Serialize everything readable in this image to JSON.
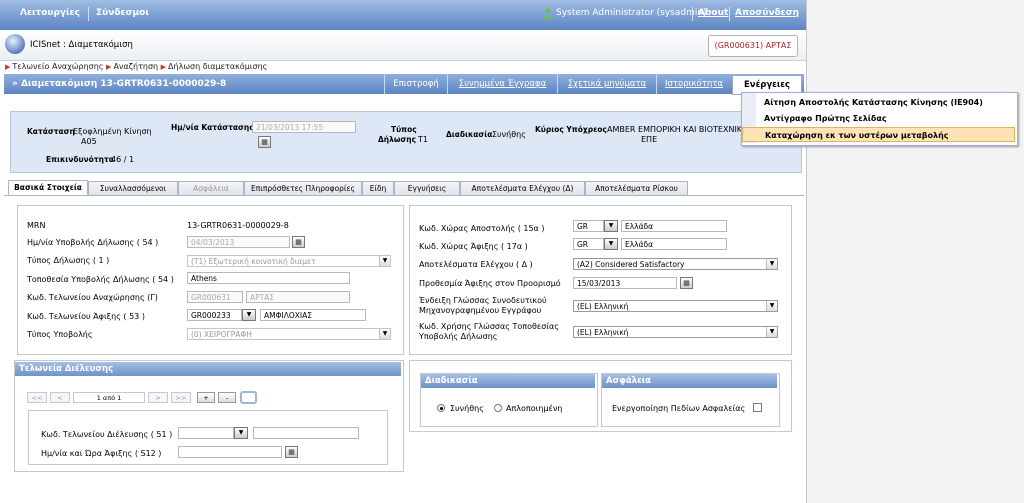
{
  "topbar": {
    "menu_functions": "Λειτουργίες",
    "menu_links": "Σύνδεσμοι",
    "user": "System Administrator (sysadmin)",
    "about": "About",
    "logout": "Αποσύνδεση"
  },
  "header": {
    "app_title": "ICISnet : Διαμετακόμιση",
    "context_office": "(GR000631) ΑΡΤΑΣ"
  },
  "breadcrumb": [
    "Τελωνείο Αναχώρησης",
    "Αναζήτηση",
    "Δήλωση διαμετακόμισης"
  ],
  "titlebar": {
    "title": "» Διαμετακόμιση 13-GRTR0631-0000029-8",
    "btn_back": "Επιστροφή",
    "btn_attachments": "Συνημμένα Έγγραφα",
    "btn_messages": "Σχετικά μηνύματα",
    "btn_history": "Ιστορικότητα",
    "btn_actions": "Ενέργειες"
  },
  "actions_menu": [
    "Αίτηση Αποστολής Κατάστασης Κίνησης (IE904)",
    "Αντίγραφο Πρώτης Σελίδας",
    "Καταχώρηση εκ των υστέρων μεταβολής"
  ],
  "status": {
    "state_label": "Κατάσταση",
    "state_value_1": "Εξοφλημένη Κίνηση",
    "state_value_2": "A05",
    "date_label": "Ημ/νία Κατάστασης",
    "date_value": "21/03/2013 17:55",
    "type_label_1": "Τύπος",
    "type_label_2": "Δήλωσης",
    "type_value": "T1",
    "procedure_label": "Διαδικασία",
    "procedure_value": "Συνήθης",
    "principal_label": "Κύριος Υπόχρεος",
    "principal_value_1": "AMBER ΕΜΠΟΡΙΚΗ ΚΑΙ ΒΙΟΤΕΧΝΙΚΗ",
    "principal_value_2": "ΕΠΕ",
    "risk_label": "Επικινδυνότητα",
    "risk_value": "46 / 1"
  },
  "tabs": [
    "Βασικά Στοιχεία",
    "Συναλλασσόμενοι",
    "Ασφάλεια",
    "Επιπρόσθετες Πληροφορίες",
    "Είδη",
    "Εγγυήσεις",
    "Αποτελέσματα Ελέγχου (Δ)",
    "Αποτελέσματα Ρίσκου"
  ],
  "left_form": {
    "mrn_label": "MRN",
    "mrn_value": "13-GRTR0631-0000029-8",
    "submit_date_label": "Ημ/νία Υποβολής Δήλωσης ( 54 )",
    "submit_date_value": "04/03/2013",
    "decl_type_label": "Τύπος Δήλωσης ( 1 )",
    "decl_type_value": "(T1) Εξωτερική κοινοτική διαμετ",
    "place_label": "Τοποθεσία Υποβολής Δήλωσης ( 54 )",
    "place_value": "Athens",
    "dep_office_label": "Κωδ. Τελωνείου Αναχώρησης (Γ)",
    "dep_office_code": "GR000631",
    "dep_office_name": "ΑΡΤΑΣ",
    "dest_office_label": "Κωδ. Τελωνείου Άφιξης ( 53 )",
    "dest_office_code": "GR000233",
    "dest_office_name": "ΑΜΦΙΛΟΧΙΑΣ",
    "submission_type_label": "Τύπος Υποβολής",
    "submission_type_value": "(0) ΧΕΙΡΟΓΡΑΦΗ"
  },
  "right_form": {
    "dispatch_country_label": "Κωδ. Χώρας Αποστολής ( 15α )",
    "dispatch_country_code": "GR",
    "dispatch_country_name": "Ελλάδα",
    "dest_country_label": "Κωδ. Χώρας Άφιξης ( 17α )",
    "dest_country_code": "GR",
    "dest_country_name": "Ελλάδα",
    "control_label": "Αποτελέσματα Ελέγχου ( Δ )",
    "control_value": "(A2) Considered Satisfactory",
    "deadline_label": "Προθεσμία Άφιξης στον Προορισμό",
    "deadline_value": "15/03/2013",
    "lang_doc_label_1": "Ένδειξη Γλώσσας Συνοδευτικού",
    "lang_doc_label_2": "Μηχανογραφημένου Εγγράφου",
    "lang_doc_value": "(EL) Ελληνική",
    "lang_place_label_1": "Κωδ. Χρήσης Γλώσσας Τοποθεσίας",
    "lang_place_label_2": "Υποβολής Δήλωσης",
    "lang_place_value": "(EL) Ελληνική"
  },
  "transit": {
    "header": "Τελωνεία Διέλευσης",
    "pager_first": "<<",
    "pager_prev": "<",
    "pager_text": "1 από 1",
    "pager_next": ">",
    "pager_last": ">>",
    "add": "+",
    "remove": "-",
    "office_label": "Κωδ. Τελωνείου Διέλευσης ( 51 )",
    "arrival_label": "Ημ/νία και Ώρα Άφιξης ( S12 )"
  },
  "procedure": {
    "header": "Διαδικασία",
    "opt_normal": "Συνήθης",
    "opt_simplified": "Απλοποιημένη",
    "selected": "Συνήθης"
  },
  "security": {
    "header": "Ασφάλεια",
    "checkbox_label": "Ενεργοποίηση Πεδίων Ασφαλείας",
    "checked": false
  },
  "colors": {
    "topbar": "#5d85c4",
    "section_header": "#6e92cb",
    "status_bg": "#dde7f6",
    "accent_red": "#b22222",
    "menu_highlight": "#fde3b5"
  }
}
